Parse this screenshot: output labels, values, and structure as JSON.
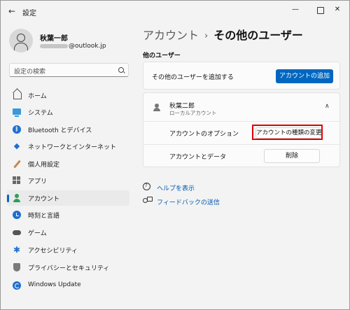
{
  "window": {
    "title": "設定",
    "back_icon": "←",
    "minimize_icon": "—",
    "close_icon": "✕"
  },
  "profile": {
    "name": "秋葉一郎",
    "email_suffix": "@outlook.jp"
  },
  "search": {
    "placeholder": "設定の検索"
  },
  "sidebar": {
    "items": [
      {
        "label": "ホーム",
        "icon": "home-icon"
      },
      {
        "label": "システム",
        "icon": "system-icon"
      },
      {
        "label": "Bluetooth とデバイス",
        "icon": "bluetooth-icon"
      },
      {
        "label": "ネットワークとインターネット",
        "icon": "network-icon"
      },
      {
        "label": "個人用設定",
        "icon": "personalization-icon"
      },
      {
        "label": "アプリ",
        "icon": "apps-icon"
      },
      {
        "label": "アカウント",
        "icon": "accounts-icon",
        "active": true
      },
      {
        "label": "時刻と言語",
        "icon": "time-language-icon"
      },
      {
        "label": "ゲーム",
        "icon": "gaming-icon"
      },
      {
        "label": "アクセシビリティ",
        "icon": "accessibility-icon"
      },
      {
        "label": "プライバシーとセキュリティ",
        "icon": "privacy-icon"
      },
      {
        "label": "Windows Update",
        "icon": "windows-update-icon"
      }
    ]
  },
  "header": {
    "breadcrumb_parent": "アカウント",
    "breadcrumb_separator": "›",
    "breadcrumb_current": "その他のユーザー"
  },
  "main": {
    "section_title": "他のユーザー",
    "add_user_label": "その他のユーザーを追加する",
    "add_account_button": "アカウントの追加",
    "user": {
      "name": "秋葉二郎",
      "type": "ローカルアカウント",
      "chevron": "∧"
    },
    "account_options_label": "アカウントのオプション",
    "change_type_button": "アカウントの種類の変更",
    "account_data_label": "アカウントとデータ",
    "delete_button": "削除"
  },
  "links": {
    "help": "ヘルプを表示",
    "feedback": "フィードバックの送信"
  },
  "colors": {
    "accent": "#0067c0",
    "highlight_border": "#e00000",
    "link": "#0058b0"
  }
}
